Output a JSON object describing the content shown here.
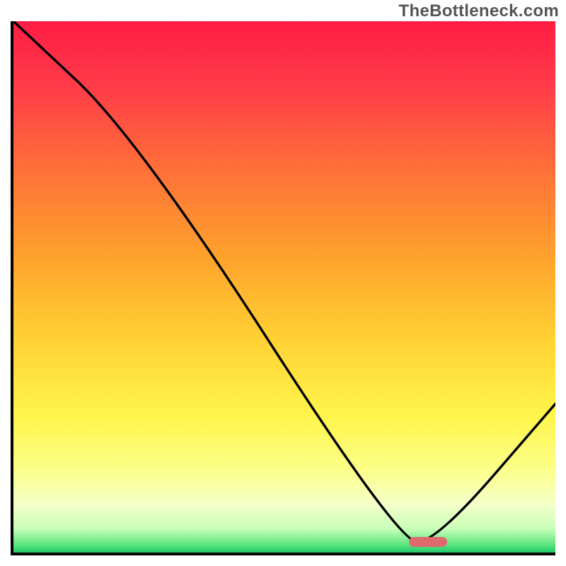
{
  "watermark": "TheBottleneck.com",
  "chart_data": {
    "type": "line",
    "title": "",
    "xlabel": "",
    "ylabel": "",
    "xlim": [
      0,
      100
    ],
    "ylim": [
      0,
      100
    ],
    "series": [
      {
        "name": "bottleneck-curve",
        "x": [
          0,
          23,
          71,
          78,
          100
        ],
        "values": [
          100,
          78,
          2,
          2,
          28
        ]
      }
    ],
    "gradient_stops": [
      {
        "pos": 0,
        "color": "#ff1c44"
      },
      {
        "pos": 0.12,
        "color": "#ff3b49"
      },
      {
        "pos": 0.28,
        "color": "#ff7038"
      },
      {
        "pos": 0.45,
        "color": "#ffa42c"
      },
      {
        "pos": 0.6,
        "color": "#ffd233"
      },
      {
        "pos": 0.74,
        "color": "#fff44a"
      },
      {
        "pos": 0.84,
        "color": "#fcff86"
      },
      {
        "pos": 0.91,
        "color": "#f4ffc9"
      },
      {
        "pos": 0.955,
        "color": "#c9ffb8"
      },
      {
        "pos": 0.985,
        "color": "#5de57f"
      },
      {
        "pos": 1.0,
        "color": "#21c96a"
      }
    ],
    "marker": {
      "name": "optimal-range",
      "x_start": 73,
      "x_end": 80,
      "y": 2,
      "color": "#de6a6e"
    }
  }
}
